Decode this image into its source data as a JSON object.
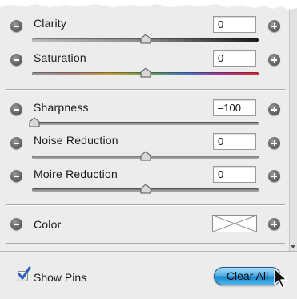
{
  "adjustments": [
    {
      "label": "Clarity",
      "value": "0",
      "slider": "clarity",
      "position": 0.5
    },
    {
      "label": "Saturation",
      "value": "0",
      "slider": "saturation",
      "position": 0.5
    },
    {
      "label": "Sharpness",
      "value": "–100",
      "slider": "gray",
      "position": 0.0
    },
    {
      "label": "Noise Reduction",
      "value": "0",
      "slider": "gray",
      "position": 0.5
    },
    {
      "label": "Moire Reduction",
      "value": "0",
      "slider": "gray",
      "position": 0.5
    },
    {
      "label": "Color"
    }
  ],
  "footer": {
    "show_pins_label": "Show Pins",
    "show_pins_checked": true,
    "clear_all_label": "Clear All"
  },
  "icons": {
    "minus": "minus-icon",
    "plus": "plus-icon",
    "checkbox": "checkmark-icon",
    "cursor": "arrow-cursor-icon"
  },
  "colors": {
    "panel_bg": "#ececec",
    "clear_all_button": "#3aa6e4",
    "checkmark": "#2a5fb8"
  }
}
